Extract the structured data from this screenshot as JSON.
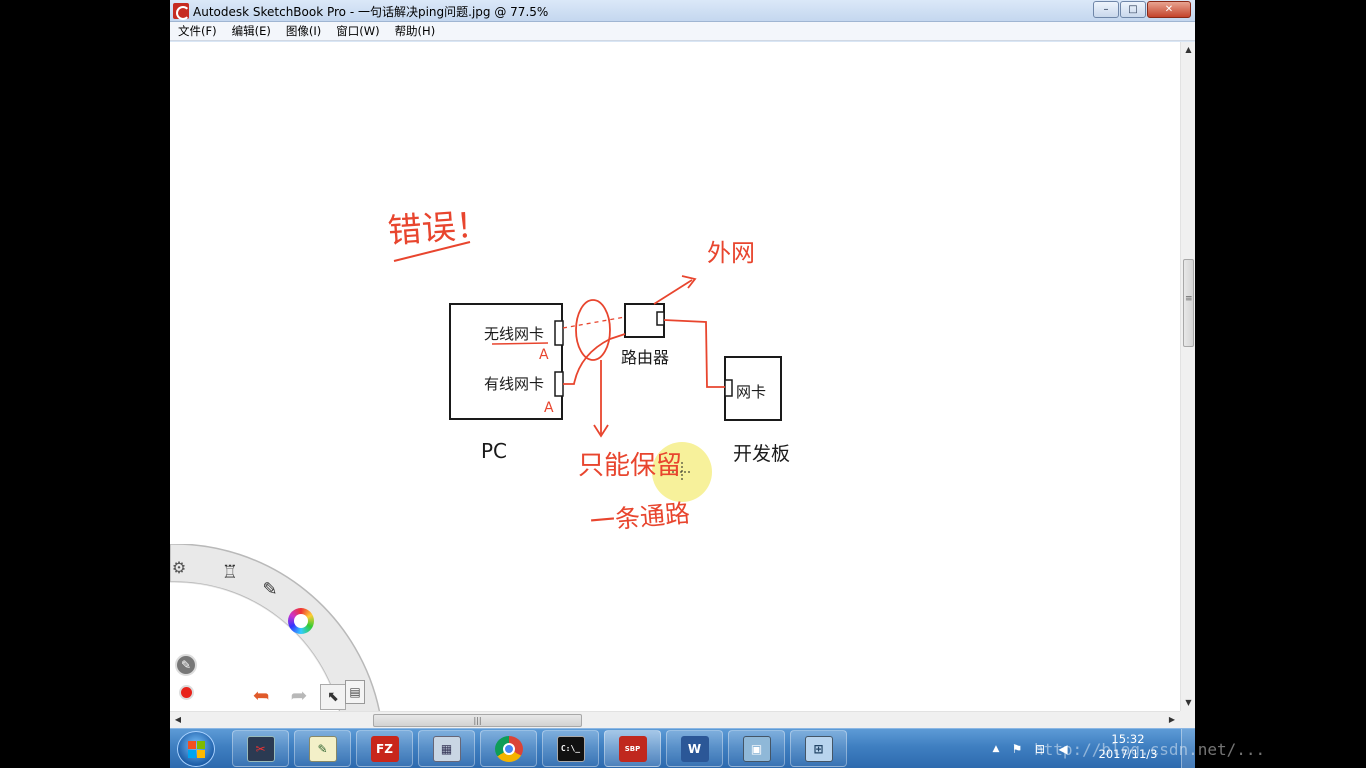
{
  "window": {
    "title": "Autodesk SketchBook Pro - 一句话解决ping问题.jpg @ 77.5%",
    "controls": {
      "minimize": "–",
      "maximize": "□",
      "close": "✕"
    }
  },
  "menu": [
    {
      "label": "文件(F)"
    },
    {
      "label": "编辑(E)"
    },
    {
      "label": "图像(I)"
    },
    {
      "label": "窗口(W)"
    },
    {
      "label": "帮助(H)"
    }
  ],
  "sketch": {
    "heading": "错误！",
    "pc_box": {
      "wireless_nic": "无线网卡",
      "wired_nic": "有线网卡",
      "port_label_a1": "A",
      "port_label_a2": "A",
      "caption": "PC"
    },
    "router": {
      "caption": "路由器"
    },
    "external": "外网",
    "board": {
      "nic": "网卡",
      "caption": "开发板"
    },
    "note_line1": "只能保留",
    "note_line2": "一条通路",
    "colors": {
      "ink": "#1a1a1a",
      "red": "#e8452e",
      "highlight": "#f6ee8a"
    }
  },
  "scrollbar": {
    "h_grip": "|||"
  },
  "lagoon": {
    "tools": [
      {
        "name": "settings-icon"
      },
      {
        "name": "brush-library-icon"
      },
      {
        "name": "paintbrush-icon"
      },
      {
        "name": "color-wheel-icon"
      },
      {
        "name": "pencil-icon"
      },
      {
        "name": "color-swatch-icon"
      },
      {
        "name": "select-icon"
      },
      {
        "name": "undo-icon"
      },
      {
        "name": "redo-icon"
      },
      {
        "name": "layer-icon"
      }
    ]
  },
  "taskbar": {
    "apps": [
      {
        "name": "snipping-tool"
      },
      {
        "name": "notepad"
      },
      {
        "name": "filezilla",
        "text": "FZ"
      },
      {
        "name": "calculator"
      },
      {
        "name": "chrome"
      },
      {
        "name": "command-prompt",
        "text": "C:\\_"
      },
      {
        "name": "sketchbook-pro",
        "text": "SBP"
      },
      {
        "name": "word",
        "text": "W"
      },
      {
        "name": "photo-viewer"
      },
      {
        "name": "remote-desktop"
      }
    ],
    "clock_time": "15:32",
    "clock_date": "2017/11/3"
  },
  "overlay": {
    "watermark": "http://blog.csdn.net/..."
  }
}
